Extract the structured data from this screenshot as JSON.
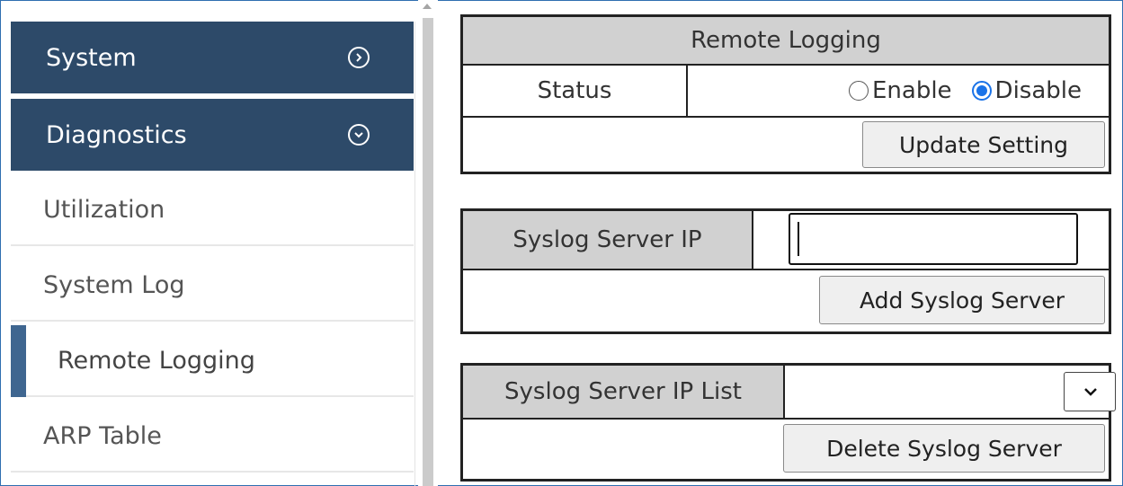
{
  "sidebar": {
    "headers": [
      {
        "label": "System",
        "icon": "chevron-right-circle-icon"
      },
      {
        "label": "Diagnostics",
        "icon": "chevron-down-circle-icon"
      }
    ],
    "items": [
      {
        "label": "Utilization"
      },
      {
        "label": "System Log"
      },
      {
        "label": "Remote Logging",
        "active": true
      },
      {
        "label": "ARP Table"
      }
    ]
  },
  "remote_logging": {
    "title": "Remote Logging",
    "status_label": "Status",
    "enable_label": "Enable",
    "disable_label": "Disable",
    "selected": "Disable",
    "update_button": "Update Setting"
  },
  "syslog_server": {
    "label": "Syslog Server IP",
    "value": "",
    "placeholder": "",
    "add_button": "Add Syslog Server"
  },
  "syslog_list": {
    "label": "Syslog Server IP List",
    "selected": "",
    "delete_button": "Delete Syslog Server"
  },
  "colors": {
    "nav_header_bg": "#2d4a69",
    "active_indicator": "#3f6690",
    "table_header_bg": "#d1d1d1",
    "radio_checked": "#1a73e8"
  }
}
